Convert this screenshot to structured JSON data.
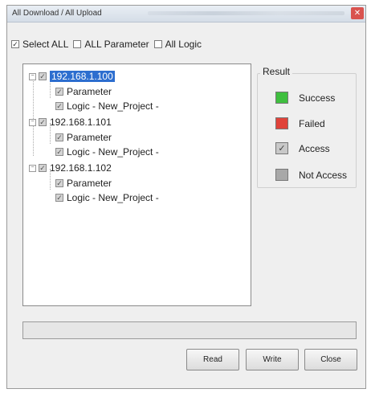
{
  "window": {
    "title": "All Download / All Upload"
  },
  "options": {
    "select_all": {
      "label": "Select ALL",
      "checked": true
    },
    "all_parameter": {
      "label": "ALL Parameter",
      "checked": false
    },
    "all_logic": {
      "label": "All Logic",
      "checked": false
    }
  },
  "tree": {
    "devices": [
      {
        "ip": "192.168.1.100",
        "selected": true,
        "children": [
          {
            "label": "Parameter"
          },
          {
            "label": "Logic - New_Project -"
          }
        ]
      },
      {
        "ip": "192.168.1.101",
        "selected": false,
        "children": [
          {
            "label": "Parameter"
          },
          {
            "label": "Logic - New_Project -"
          }
        ]
      },
      {
        "ip": "192.168.1.102",
        "selected": false,
        "children": [
          {
            "label": "Parameter"
          },
          {
            "label": "Logic - New_Project -"
          }
        ]
      }
    ]
  },
  "result": {
    "title": "Result",
    "items": [
      {
        "label": "Success",
        "color": "#3fbf3f"
      },
      {
        "label": "Failed",
        "color": "#e0433a"
      },
      {
        "label": "Access",
        "color": "#c8c8c8"
      },
      {
        "label": "Not Access",
        "color": "#a8a8a8"
      }
    ]
  },
  "progress": {
    "value": 0
  },
  "buttons": {
    "read": "Read",
    "write": "Write",
    "close": "Close"
  }
}
